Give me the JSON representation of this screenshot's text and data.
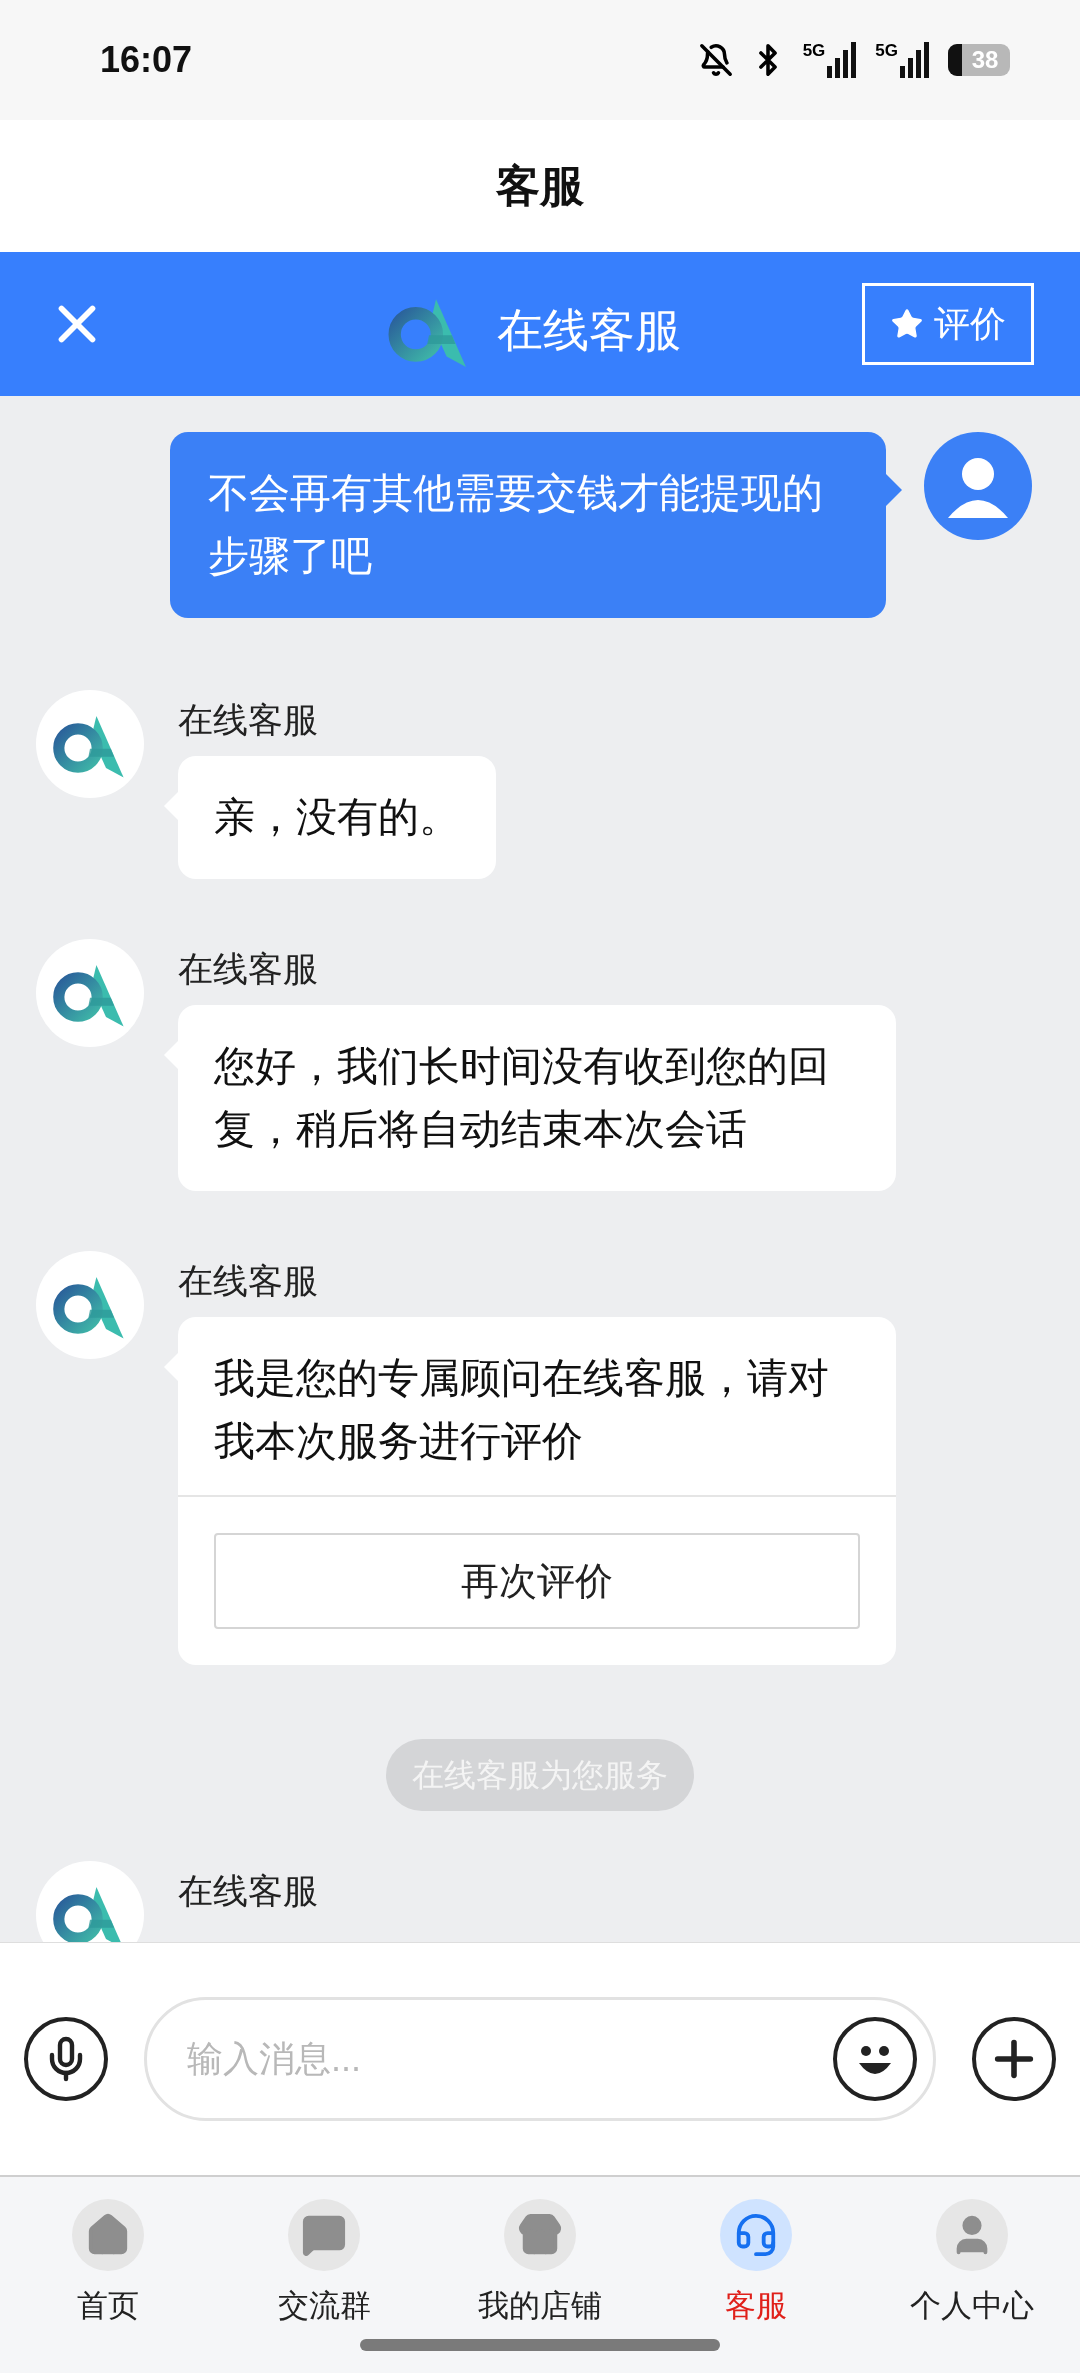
{
  "status_bar": {
    "time": "16:07",
    "network_1": "5G",
    "network_2": "5G",
    "battery": "38"
  },
  "page_title": "客服",
  "chat_header": {
    "title": "在线客服",
    "rate_button": "评价"
  },
  "messages": [
    {
      "kind": "user",
      "text": "不会再有其他需要交钱才能提现的步骤了吧"
    },
    {
      "kind": "agent",
      "sender": "在线客服",
      "text": "亲，没有的。"
    },
    {
      "kind": "agent",
      "sender": "在线客服",
      "text": "您好，我们长时间没有收到您的回复，稍后将自动结束本次会话"
    },
    {
      "kind": "rating",
      "sender": "在线客服",
      "text": "我是您的专属顾问在线客服，请对我本次服务进行评价",
      "button": "再次评价"
    },
    {
      "kind": "system",
      "text": "在线客服为您服务"
    },
    {
      "kind": "partial",
      "sender": "在线客服"
    }
  ],
  "input": {
    "placeholder": "输入消息..."
  },
  "nav": [
    {
      "label": "首页",
      "selected": false
    },
    {
      "label": "交流群",
      "selected": false
    },
    {
      "label": "我的店铺",
      "selected": false
    },
    {
      "label": "客服",
      "selected": true
    },
    {
      "label": "个人中心",
      "selected": false
    }
  ]
}
